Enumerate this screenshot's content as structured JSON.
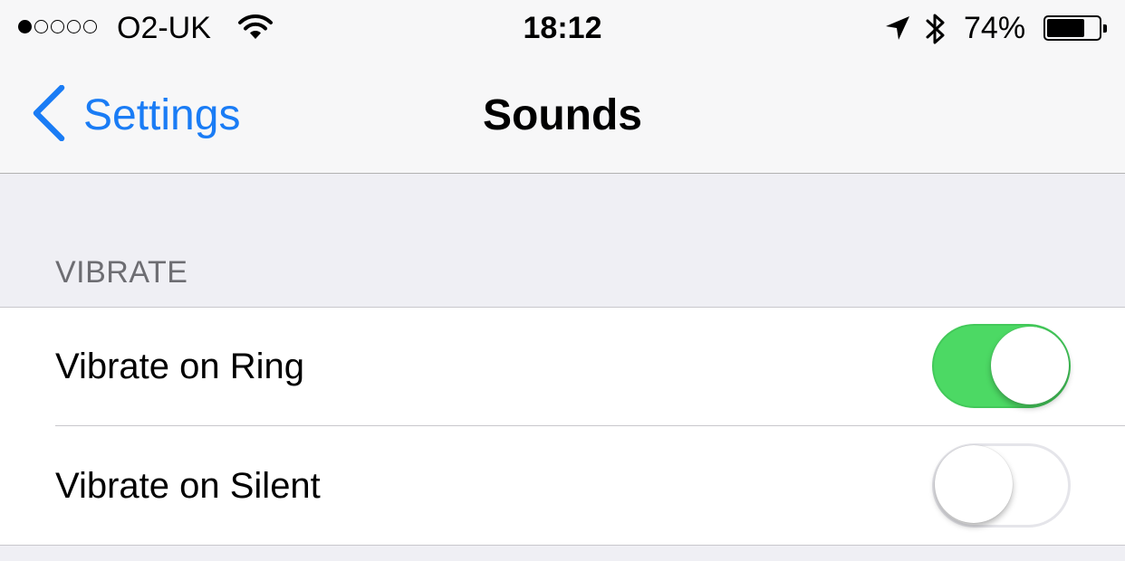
{
  "status_bar": {
    "signal_bars_filled": 1,
    "signal_bars_total": 5,
    "carrier": "O2-UK",
    "time": "18:12",
    "battery_percent": "74%",
    "battery_level": 0.74,
    "icons": [
      "wifi-icon",
      "location-arrow-icon",
      "bluetooth-icon",
      "battery-icon"
    ]
  },
  "nav": {
    "back_label": "Settings",
    "title": "Sounds",
    "accent_color": "#1a7cf5"
  },
  "section": {
    "header": "VIBRATE",
    "rows": [
      {
        "label": "Vibrate on Ring",
        "on": true
      },
      {
        "label": "Vibrate on Silent",
        "on": false
      }
    ]
  },
  "colors": {
    "switch_on": "#4cd964",
    "background": "#efeff4"
  }
}
